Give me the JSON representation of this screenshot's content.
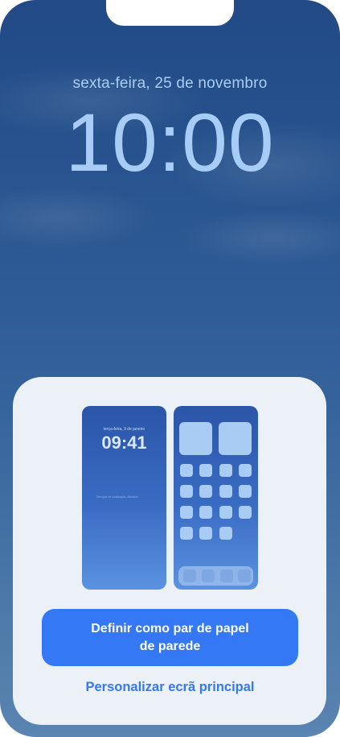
{
  "lock_screen": {
    "date": "sexta-feira, 25 de novembro",
    "time": "10:00"
  },
  "preview": {
    "lock": {
      "date": "terça-feira, 9 de janeiro",
      "time": "09:41",
      "note": "Serviços de localização: Ativados"
    }
  },
  "actions": {
    "primary_line1": "Definir como par de papel",
    "primary_line2": "de parede",
    "secondary": "Personalizar ecrã principal"
  },
  "colors": {
    "accent": "#3478f6",
    "sheet": "#ecf1f7",
    "wallpaper_top": "#214a86",
    "wallpaper_bottom": "#5a84b1"
  }
}
